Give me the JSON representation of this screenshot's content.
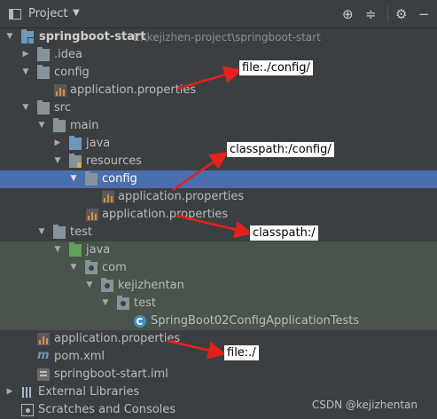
{
  "header": {
    "title": "Project",
    "dropdown_icon": "chevron-down-icon",
    "tools": [
      "locate-icon",
      "collapse-icon",
      "gear-icon",
      "hide-icon"
    ]
  },
  "tree": [
    {
      "label": "springboot-start",
      "path": "E:\\kejizhen-project\\springboot-start",
      "expanded": true,
      "icon": "module-folder-icon"
    },
    {
      "label": ".idea",
      "expanded": false,
      "icon": "folder-icon"
    },
    {
      "label": "config",
      "expanded": true,
      "icon": "folder-icon"
    },
    {
      "label": "application.properties",
      "icon": "properties-file-icon"
    },
    {
      "label": "src",
      "expanded": true,
      "icon": "folder-icon"
    },
    {
      "label": "main",
      "expanded": true,
      "icon": "folder-icon"
    },
    {
      "label": "java",
      "expanded": false,
      "icon": "source-folder-icon"
    },
    {
      "label": "resources",
      "expanded": true,
      "icon": "resources-folder-icon"
    },
    {
      "label": "config",
      "expanded": true,
      "icon": "folder-icon",
      "selected": true
    },
    {
      "label": "application.properties",
      "icon": "properties-file-icon"
    },
    {
      "label": "application.properties",
      "icon": "properties-file-icon"
    },
    {
      "label": "test",
      "expanded": true,
      "icon": "folder-icon"
    },
    {
      "label": "java",
      "expanded": true,
      "icon": "test-folder-icon"
    },
    {
      "label": "com",
      "expanded": true,
      "icon": "package-icon"
    },
    {
      "label": "kejizhentan",
      "expanded": true,
      "icon": "package-icon"
    },
    {
      "label": "test",
      "expanded": true,
      "icon": "package-icon"
    },
    {
      "label": "SpringBoot02ConfigApplicationTests",
      "icon": "test-class-icon"
    },
    {
      "label": "application.properties",
      "icon": "properties-file-icon"
    },
    {
      "label": "pom.xml",
      "icon": "maven-icon"
    },
    {
      "label": "springboot-start.iml",
      "icon": "iml-file-icon"
    },
    {
      "label": "External Libraries",
      "expanded": false,
      "icon": "libraries-icon"
    },
    {
      "label": "Scratches and Consoles",
      "icon": "scratches-icon"
    }
  ],
  "callouts": [
    "file:./config/",
    "classpath:/config/",
    "classpath:/",
    "file:./"
  ],
  "watermark": "CSDN @kejizhentan",
  "colors": {
    "panel_bg": "#3c3f41",
    "selection": "#4b6eaf",
    "test_bg": "#49544a",
    "arrow": "#e8201a"
  }
}
